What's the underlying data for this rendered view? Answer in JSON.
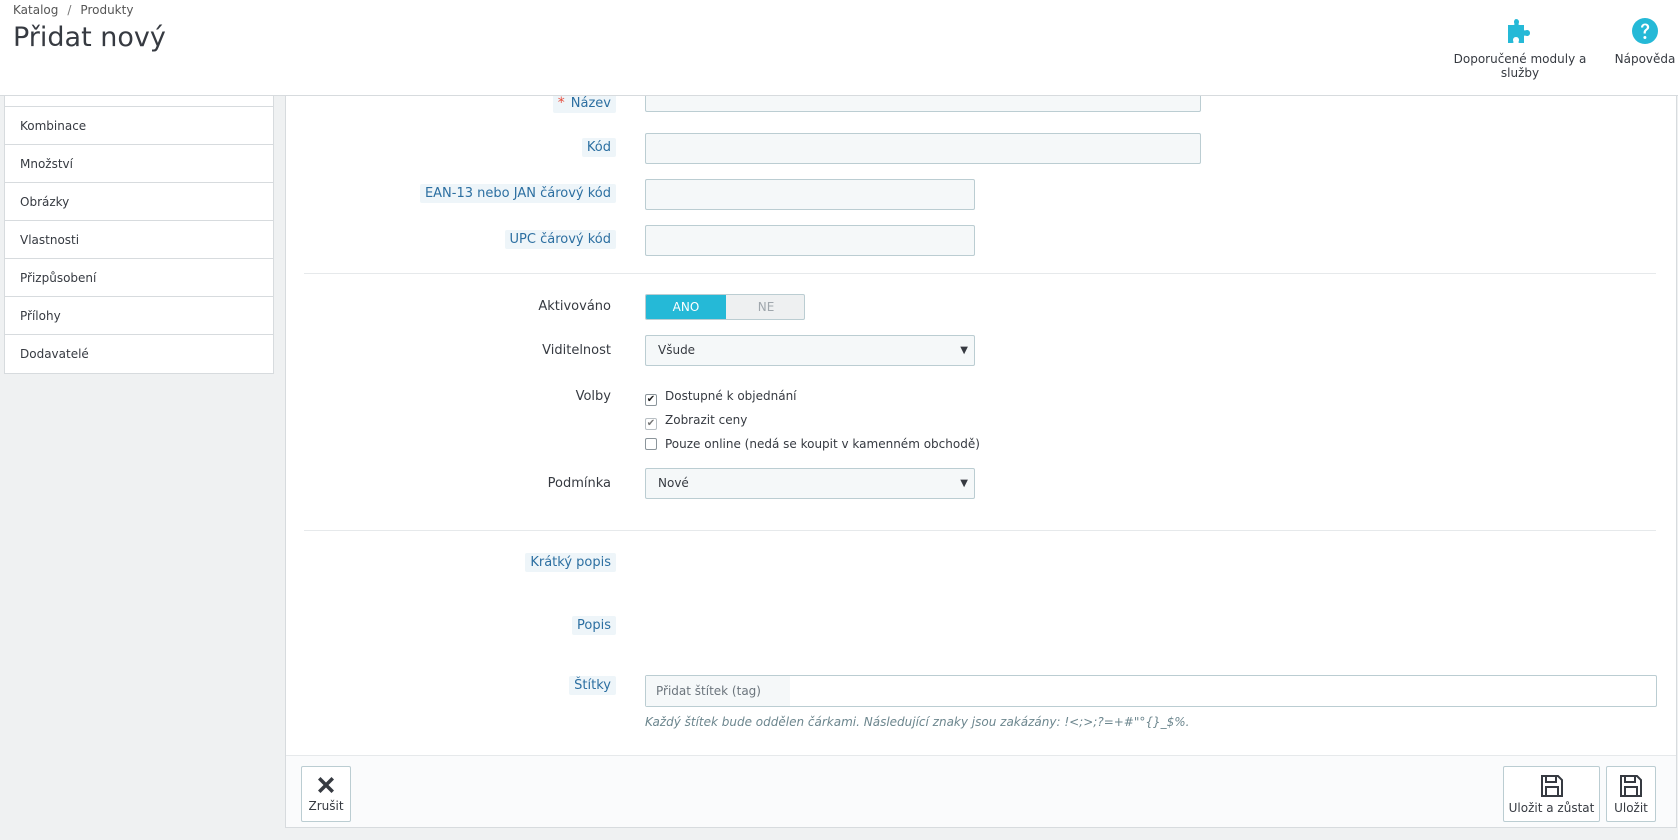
{
  "breadcrumb": {
    "items": [
      "Katalog",
      "Produkty"
    ],
    "separator": "/"
  },
  "page": {
    "title": "Přidat nový"
  },
  "toolbar": {
    "modules_label": "Doporučené moduly a služby",
    "help_label": "Nápověda",
    "accent": "#25b9d7"
  },
  "sidebar": {
    "tabs": [
      "Kombinace",
      "Množství",
      "Obrázky",
      "Vlastnosti",
      "Přizpůsobení",
      "Přílohy",
      "Dodavatelé"
    ]
  },
  "form": {
    "name_label": "Název",
    "code_label": "Kód",
    "ean_label": "EAN-13 nebo JAN čárový kód",
    "upc_label": "UPC čárový kód",
    "active_label": "Aktivováno",
    "active_yes": "ANO",
    "active_no": "NE",
    "visibility_label": "Viditelnost",
    "visibility_value": "Všude",
    "options_label": "Volby",
    "option_available": "Dostupné k objednání",
    "option_show_price": "Zobrazit ceny",
    "option_online_only": "Pouze online (nedá se koupit v kamenném obchodě)",
    "condition_label": "Podmínka",
    "condition_value": "Nové",
    "short_desc_label": "Krátký popis",
    "desc_label": "Popis",
    "tags_label": "Štítky",
    "tags_placeholder": "Přidat štítek (tag)",
    "tags_help": "Každý štítek bude oddělen čárkami. Následující znaky jsou zakázány: !<;>;?=+#\"°{}_$%."
  },
  "footer": {
    "cancel_label": "Zrušit",
    "save_stay_label": "Uložit a zůstat",
    "save_label": "Uložit"
  }
}
